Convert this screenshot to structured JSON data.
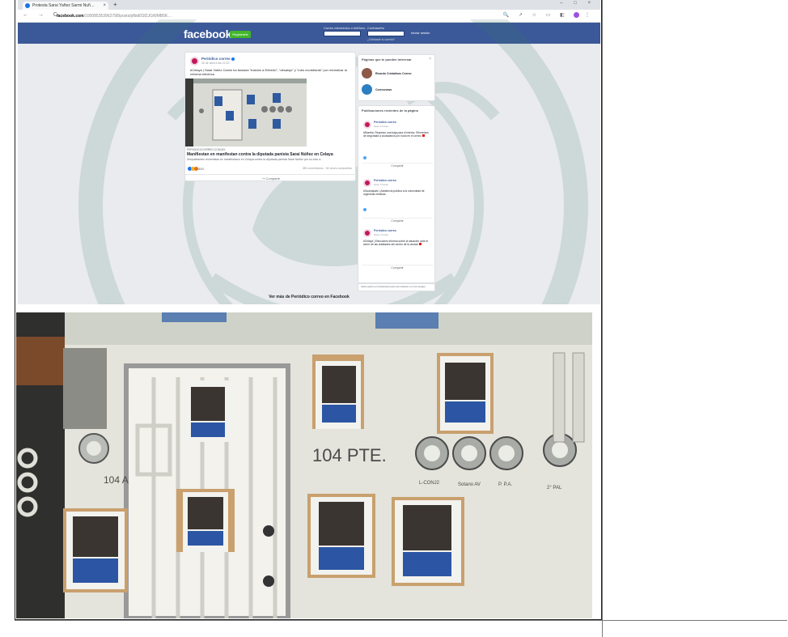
{
  "browser": {
    "tab_title": "Protesta Sarai Yañez Sarmi Nuñ…",
    "new_tab_symbol": "+",
    "window_controls": "–  □  ×",
    "nav_symbols": "← → C",
    "url_domain": "facebook.com",
    "url_path": "/100085353962798/posts/pfbid0Sf2JGWMB5K…"
  },
  "facebook": {
    "logo": "facebook",
    "signup_button": "Registrarte",
    "login": {
      "email_label": "Correo electrónico o teléfono",
      "password_label": "Contraseña",
      "forgot_link": "¿Olvidaste tu cuenta?",
      "login_button": "Iniciar sesión"
    },
    "post": {
      "author": "Periódico correo",
      "date": "30 de abril a las 22:23",
      "text": "#Celaya | Sarai Yañez Camin ha llamado “traición a Eriberto”, “desalojo” y “robo exorbitante” por reivindicar la reforma eléctrica",
      "link_caption": "PERIODICOCORREO.COM.MX",
      "link_title": "Manifiestan en manifestan contra la diputada panista Sarai Núñez en Celaya",
      "link_description": "Simpatizantes morenistas se manifestaron en Celaya contra la diputada panista Sarai Núñez por su voto a…",
      "reactions_count": "850",
      "stats": "380 comentarios · 54 veces compartido",
      "share_label": "Compartir"
    },
    "sidebar_pages": {
      "title": "Páginas que te pueden interesar",
      "close": "×",
      "items": [
        {
          "name": "Ricardo Cristalinos Correo"
        },
        {
          "name": "Correonews"
        }
      ]
    },
    "sidebar_posts": {
      "title": "Publicaciones recientes de la página",
      "items": [
        {
          "author": "Periódico correo",
          "date": "Hace 2 horas",
          "text": "#Morelia: Reportan una baja para el interior. Elementos de seguridad a ciudadanos por ruido en el centro"
        },
        {
          "author": "Periódico correo",
          "date": "Hace 3 horas",
          "text": "#Guanajuato | Asistencia pública a la comunidad de urgencias médicas"
        },
        {
          "author": "Periódico correo",
          "date": "Hace 4 horas",
          "text": "#Celaya | Elecciones informa sobre la situación ante el cierre de las vialidades del centro de la ciudad"
        }
      ],
      "share_label": "Compartir"
    },
    "login_cta": "Inicia sesión en Facebook para comunicarte con tus amigos",
    "see_more": "Ver más de Periódico correo en Facebook"
  },
  "photo": {
    "address_number": "104 PTE.",
    "left_number": "104 A",
    "meter_labels": [
      "L-CONJ2",
      "Sotano AV",
      "P. P.A.",
      "2° PAL"
    ]
  },
  "colors": {
    "facebook_blue": "#3b5998",
    "page_bg": "#e9ebee",
    "signup_green": "#42b72a",
    "wall": "#e7e7e1"
  }
}
